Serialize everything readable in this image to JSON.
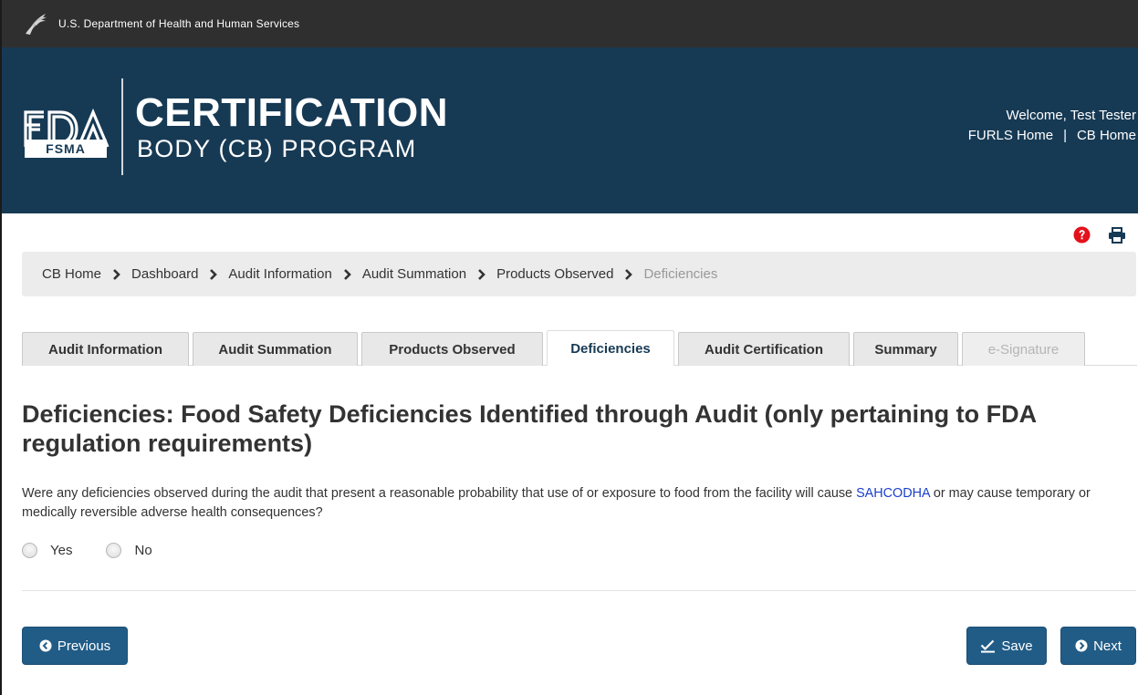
{
  "agency_bar": {
    "text": "U.S. Department of Health and Human Services"
  },
  "banner": {
    "logo_text": "FDA",
    "logo_badge": "FSMA",
    "title": "CERTIFICATION",
    "subtitle": "BODY (CB) PROGRAM",
    "welcome": "Welcome, Test Tester",
    "links": [
      {
        "label": "FURLS Home"
      },
      {
        "label": "CB Home"
      }
    ],
    "link_separator": "|"
  },
  "toolbar": {
    "help_icon": "question-circle-icon",
    "print_icon": "print-icon",
    "help_color": "#e3111b",
    "print_color": "#173a54"
  },
  "breadcrumb": [
    {
      "label": "CB Home",
      "active": false
    },
    {
      "label": "Dashboard",
      "active": false
    },
    {
      "label": "Audit Information",
      "active": false
    },
    {
      "label": "Audit Summation",
      "active": false
    },
    {
      "label": "Products Observed",
      "active": false
    },
    {
      "label": "Deficiencies",
      "active": true
    }
  ],
  "tabs": [
    {
      "label": "Audit Information",
      "state": "normal"
    },
    {
      "label": "Audit Summation",
      "state": "normal"
    },
    {
      "label": "Products Observed",
      "state": "normal"
    },
    {
      "label": "Deficiencies",
      "state": "active"
    },
    {
      "label": "Audit Certification",
      "state": "normal"
    },
    {
      "label": "Summary",
      "state": "normal"
    },
    {
      "label": "e-Signature",
      "state": "disabled"
    }
  ],
  "main": {
    "heading": "Deficiencies: Food Safety Deficiencies Identified through Audit (only pertaining to FDA regulation requirements)",
    "question_before": "Were any deficiencies observed during the audit that present a reasonable probability that use of or exposure to food from the facility will cause ",
    "question_link": "SAHCODHA",
    "question_after": " or may cause temporary or medically reversible adverse health consequences?",
    "options": [
      {
        "label": "Yes",
        "selected": false
      },
      {
        "label": "No",
        "selected": false
      }
    ]
  },
  "buttons": {
    "previous": "Previous",
    "save": "Save",
    "next": "Next",
    "color": "#215c87"
  },
  "colors": {
    "top_bar": "#2f2f2f",
    "banner": "#173a54",
    "link": "#1a3fcc"
  }
}
